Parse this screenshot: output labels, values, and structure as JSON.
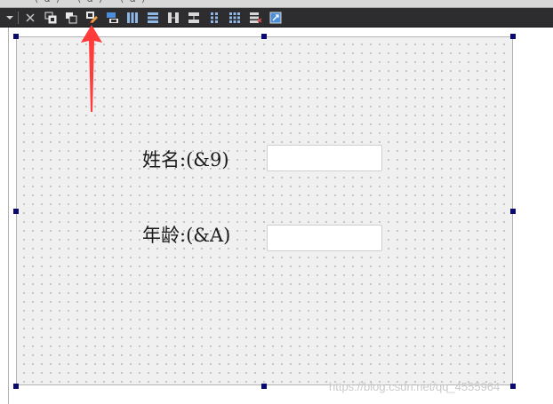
{
  "top_strip": {
    "ghost_text": "(&) (&) (&)"
  },
  "toolbar": {
    "buttons": [
      {
        "name": "dropdown-icon"
      },
      {
        "name": "close-icon"
      },
      {
        "name": "bring-to-front-icon"
      },
      {
        "name": "send-to-back-icon"
      },
      {
        "name": "edit-tab-order-icon",
        "highlighted": true
      },
      {
        "name": "edit-buddies-icon"
      },
      {
        "name": "layout-horizontal-icon"
      },
      {
        "name": "layout-vertical-icon"
      },
      {
        "name": "layout-horizontal-splitter-icon"
      },
      {
        "name": "layout-vertical-splitter-icon"
      },
      {
        "name": "layout-form-icon"
      },
      {
        "name": "layout-grid-icon"
      },
      {
        "name": "break-layout-icon"
      },
      {
        "name": "adjust-size-icon"
      }
    ]
  },
  "form": {
    "fields": [
      {
        "label": "姓名:(&9)",
        "value": ""
      },
      {
        "label": "年龄:(&A)",
        "value": ""
      }
    ]
  },
  "annotation": {
    "type": "arrow",
    "color": "#ff3b3b",
    "points_to": "edit-tab-order-icon"
  },
  "watermark": "https://blog.csdn.net/qq_4555964",
  "colors": {
    "toolbar_bg": "#2d2d30",
    "form_bg": "#f0f0f0",
    "handle": "#0a0a6e",
    "arrow": "#ff3b3b"
  }
}
